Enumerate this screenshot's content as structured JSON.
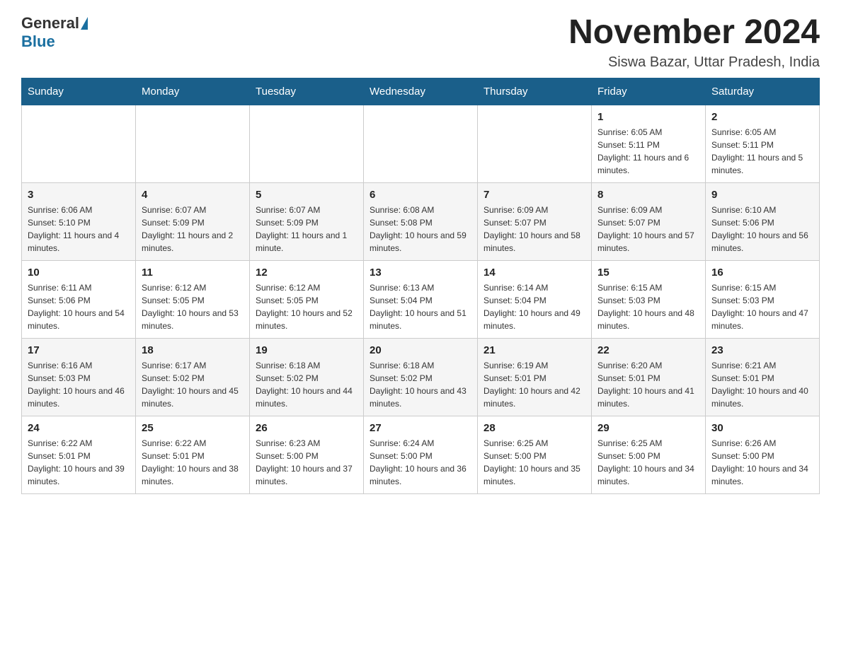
{
  "header": {
    "logo_general": "General",
    "logo_blue": "Blue",
    "month_title": "November 2024",
    "location": "Siswa Bazar, Uttar Pradesh, India"
  },
  "days_of_week": [
    "Sunday",
    "Monday",
    "Tuesday",
    "Wednesday",
    "Thursday",
    "Friday",
    "Saturday"
  ],
  "weeks": [
    [
      {
        "day": "",
        "info": ""
      },
      {
        "day": "",
        "info": ""
      },
      {
        "day": "",
        "info": ""
      },
      {
        "day": "",
        "info": ""
      },
      {
        "day": "",
        "info": ""
      },
      {
        "day": "1",
        "info": "Sunrise: 6:05 AM\nSunset: 5:11 PM\nDaylight: 11 hours and 6 minutes."
      },
      {
        "day": "2",
        "info": "Sunrise: 6:05 AM\nSunset: 5:11 PM\nDaylight: 11 hours and 5 minutes."
      }
    ],
    [
      {
        "day": "3",
        "info": "Sunrise: 6:06 AM\nSunset: 5:10 PM\nDaylight: 11 hours and 4 minutes."
      },
      {
        "day": "4",
        "info": "Sunrise: 6:07 AM\nSunset: 5:09 PM\nDaylight: 11 hours and 2 minutes."
      },
      {
        "day": "5",
        "info": "Sunrise: 6:07 AM\nSunset: 5:09 PM\nDaylight: 11 hours and 1 minute."
      },
      {
        "day": "6",
        "info": "Sunrise: 6:08 AM\nSunset: 5:08 PM\nDaylight: 10 hours and 59 minutes."
      },
      {
        "day": "7",
        "info": "Sunrise: 6:09 AM\nSunset: 5:07 PM\nDaylight: 10 hours and 58 minutes."
      },
      {
        "day": "8",
        "info": "Sunrise: 6:09 AM\nSunset: 5:07 PM\nDaylight: 10 hours and 57 minutes."
      },
      {
        "day": "9",
        "info": "Sunrise: 6:10 AM\nSunset: 5:06 PM\nDaylight: 10 hours and 56 minutes."
      }
    ],
    [
      {
        "day": "10",
        "info": "Sunrise: 6:11 AM\nSunset: 5:06 PM\nDaylight: 10 hours and 54 minutes."
      },
      {
        "day": "11",
        "info": "Sunrise: 6:12 AM\nSunset: 5:05 PM\nDaylight: 10 hours and 53 minutes."
      },
      {
        "day": "12",
        "info": "Sunrise: 6:12 AM\nSunset: 5:05 PM\nDaylight: 10 hours and 52 minutes."
      },
      {
        "day": "13",
        "info": "Sunrise: 6:13 AM\nSunset: 5:04 PM\nDaylight: 10 hours and 51 minutes."
      },
      {
        "day": "14",
        "info": "Sunrise: 6:14 AM\nSunset: 5:04 PM\nDaylight: 10 hours and 49 minutes."
      },
      {
        "day": "15",
        "info": "Sunrise: 6:15 AM\nSunset: 5:03 PM\nDaylight: 10 hours and 48 minutes."
      },
      {
        "day": "16",
        "info": "Sunrise: 6:15 AM\nSunset: 5:03 PM\nDaylight: 10 hours and 47 minutes."
      }
    ],
    [
      {
        "day": "17",
        "info": "Sunrise: 6:16 AM\nSunset: 5:03 PM\nDaylight: 10 hours and 46 minutes."
      },
      {
        "day": "18",
        "info": "Sunrise: 6:17 AM\nSunset: 5:02 PM\nDaylight: 10 hours and 45 minutes."
      },
      {
        "day": "19",
        "info": "Sunrise: 6:18 AM\nSunset: 5:02 PM\nDaylight: 10 hours and 44 minutes."
      },
      {
        "day": "20",
        "info": "Sunrise: 6:18 AM\nSunset: 5:02 PM\nDaylight: 10 hours and 43 minutes."
      },
      {
        "day": "21",
        "info": "Sunrise: 6:19 AM\nSunset: 5:01 PM\nDaylight: 10 hours and 42 minutes."
      },
      {
        "day": "22",
        "info": "Sunrise: 6:20 AM\nSunset: 5:01 PM\nDaylight: 10 hours and 41 minutes."
      },
      {
        "day": "23",
        "info": "Sunrise: 6:21 AM\nSunset: 5:01 PM\nDaylight: 10 hours and 40 minutes."
      }
    ],
    [
      {
        "day": "24",
        "info": "Sunrise: 6:22 AM\nSunset: 5:01 PM\nDaylight: 10 hours and 39 minutes."
      },
      {
        "day": "25",
        "info": "Sunrise: 6:22 AM\nSunset: 5:01 PM\nDaylight: 10 hours and 38 minutes."
      },
      {
        "day": "26",
        "info": "Sunrise: 6:23 AM\nSunset: 5:00 PM\nDaylight: 10 hours and 37 minutes."
      },
      {
        "day": "27",
        "info": "Sunrise: 6:24 AM\nSunset: 5:00 PM\nDaylight: 10 hours and 36 minutes."
      },
      {
        "day": "28",
        "info": "Sunrise: 6:25 AM\nSunset: 5:00 PM\nDaylight: 10 hours and 35 minutes."
      },
      {
        "day": "29",
        "info": "Sunrise: 6:25 AM\nSunset: 5:00 PM\nDaylight: 10 hours and 34 minutes."
      },
      {
        "day": "30",
        "info": "Sunrise: 6:26 AM\nSunset: 5:00 PM\nDaylight: 10 hours and 34 minutes."
      }
    ]
  ]
}
